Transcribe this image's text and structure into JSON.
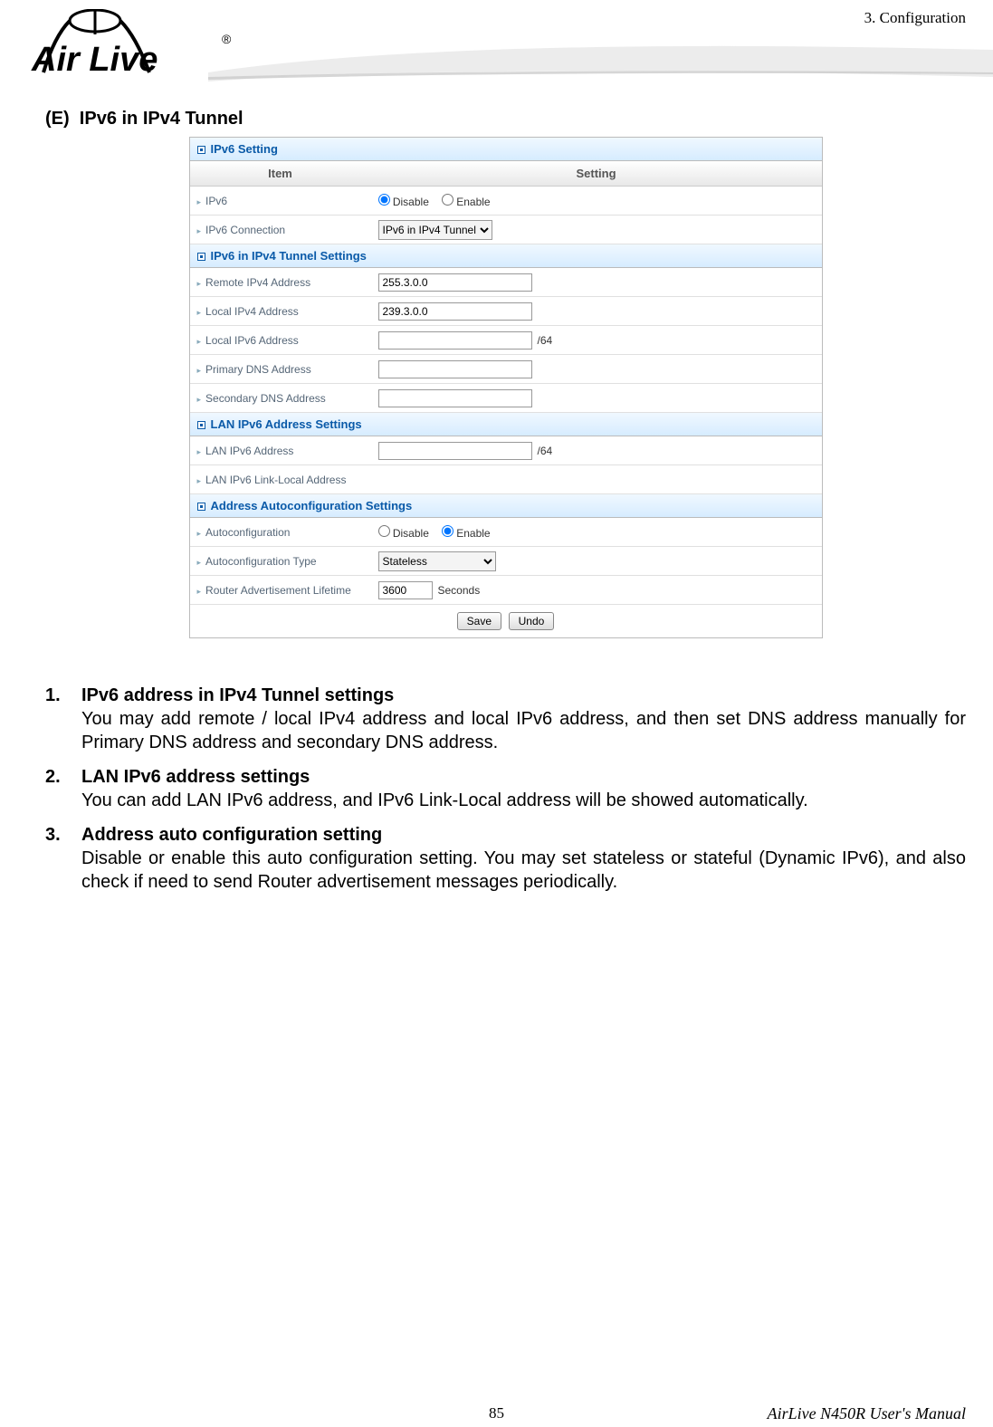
{
  "header": {
    "chapter": "3. Configuration",
    "logo_text": "Air Live",
    "logo_reg": "®"
  },
  "section": {
    "prefix": "(E)",
    "title": "IPv6 in IPv4 Tunnel"
  },
  "panel": {
    "ipv6_setting_header": "IPv6 Setting",
    "col_item": "Item",
    "col_setting": "Setting",
    "rows": {
      "ipv6_label": "IPv6",
      "disable_label": "Disable",
      "enable_label": "Enable",
      "ipv6_connection_label": "IPv6 Connection",
      "ipv6_connection_value": "IPv6 in IPv4 Tunnel",
      "tunnel_header": "IPv6 in IPv4 Tunnel Settings",
      "remote_ipv4_label": "Remote IPv4 Address",
      "remote_ipv4_value": "255.3.0.0",
      "local_ipv4_label": "Local IPv4 Address",
      "local_ipv4_value": "239.3.0.0",
      "local_ipv6_label": "Local IPv6 Address",
      "local_ipv6_suffix": "/64",
      "primary_dns_label": "Primary DNS Address",
      "secondary_dns_label": "Secondary DNS Address",
      "lan_header": "LAN IPv6 Address Settings",
      "lan_ipv6_label": "LAN IPv6 Address",
      "lan_ipv6_suffix": "/64",
      "lan_linklocal_label": "LAN IPv6 Link-Local Address",
      "autoconf_header": "Address Autoconfiguration Settings",
      "autoconf_label": "Autoconfiguration",
      "autoconf_type_label": "Autoconfiguration Type",
      "autoconf_type_value": "Stateless",
      "router_adv_label": "Router Advertisement Lifetime",
      "router_adv_value": "3600",
      "seconds_label": "Seconds"
    },
    "buttons": {
      "save": "Save",
      "undo": "Undo"
    }
  },
  "body": {
    "item1_num": "1.",
    "item1_title": "IPv6 address in IPv4 Tunnel settings",
    "item1_desc": "You may add remote / local IPv4 address and local IPv6 address, and then set DNS address manually for Primary DNS address and secondary DNS address.",
    "item2_num": "2.",
    "item2_title": "LAN IPv6 address settings",
    "item2_desc": "You can add LAN IPv6 address, and IPv6 Link-Local address will be showed automatically.",
    "item3_num": "3.",
    "item3_title": "Address auto configuration setting",
    "item3_desc": "Disable or enable this auto configuration setting. You may set stateless or stateful (Dynamic IPv6), and also check if need to send Router advertisement messages periodically."
  },
  "footer": {
    "page": "85",
    "manual": "AirLive N450R User's Manual"
  }
}
